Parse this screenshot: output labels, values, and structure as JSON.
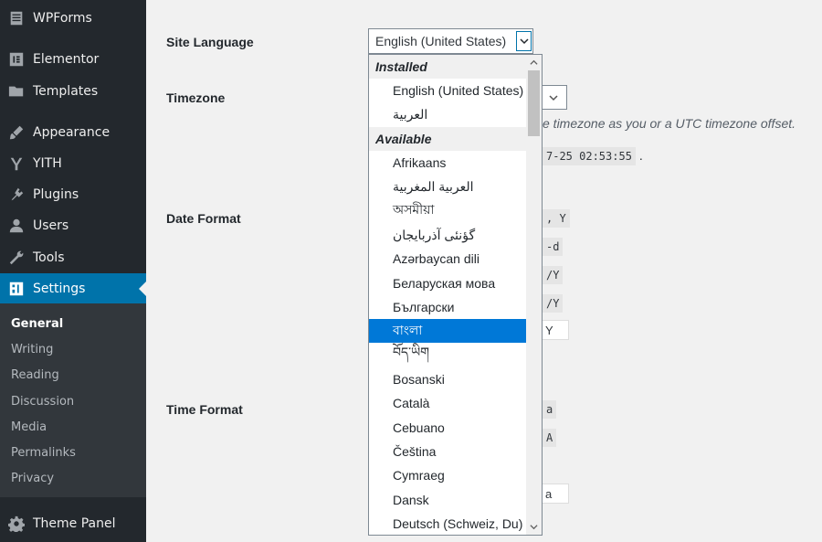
{
  "sidebar": {
    "items": [
      {
        "label": "WPForms",
        "icon": "wpforms-icon"
      },
      {
        "label": "Elementor",
        "icon": "elementor-icon"
      },
      {
        "label": "Templates",
        "icon": "folder-icon"
      },
      {
        "label": "Appearance",
        "icon": "brush-icon"
      },
      {
        "label": "YITH",
        "icon": "yith-icon"
      },
      {
        "label": "Plugins",
        "icon": "plugin-icon"
      },
      {
        "label": "Users",
        "icon": "user-icon"
      },
      {
        "label": "Tools",
        "icon": "wrench-icon"
      },
      {
        "label": "Settings",
        "icon": "settings-icon"
      },
      {
        "label": "Theme Panel",
        "icon": "gear-icon"
      }
    ],
    "submenu": [
      "General",
      "Writing",
      "Reading",
      "Discussion",
      "Media",
      "Permalinks",
      "Privacy"
    ]
  },
  "form": {
    "site_language_label": "Site Language",
    "timezone_label": "Timezone",
    "date_format_label": "Date Format",
    "time_format_label": "Time Format",
    "site_language_value": "English (United States)",
    "timezone_hint": "e timezone as you or a UTC timezone offset.",
    "utc_time_fragment": "7-25 02:53:55",
    "utc_time_suffix": ".",
    "date_fragments": [
      ", Y",
      "-d",
      "/Y",
      "/Y",
      "Y"
    ],
    "time_fragments": [
      "a",
      "A",
      "a"
    ]
  },
  "dropdown": {
    "groups": {
      "installed": "Installed",
      "available": "Available"
    },
    "installed": [
      "English (United States)",
      "العربية"
    ],
    "available": [
      "Afrikaans",
      "العربية المغربية",
      "অসমীয়া",
      "گؤنئی آذربایجان",
      "Azərbaycan dili",
      "Беларуская мова",
      "Български",
      "বাংলা",
      "བོད་ཡིག",
      "Bosanski",
      "Català",
      "Cebuano",
      "Čeština",
      "Cymraeg",
      "Dansk",
      "Deutsch (Schweiz, Du)"
    ],
    "selected": "বাংলা"
  },
  "colors": {
    "sidebar_bg": "#23282d",
    "active": "#0073aa",
    "selected_option": "#0078d7"
  }
}
